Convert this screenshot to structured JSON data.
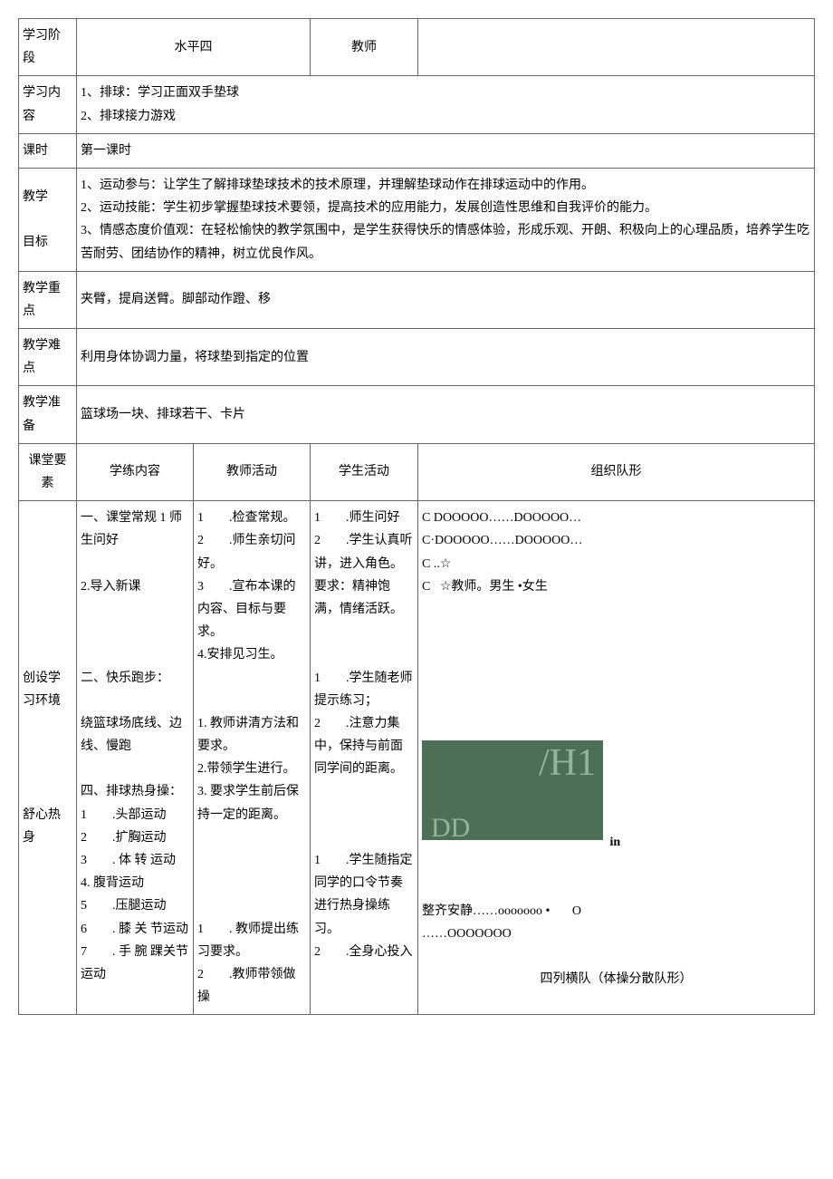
{
  "header": {
    "stage_label": "学习阶段",
    "stage_value": "水平四",
    "teacher_label": "教师",
    "teacher_value": ""
  },
  "content": {
    "label": "学习内容",
    "line1": "1、排球：学习正面双手垫球",
    "line2": "2、排球接力游戏"
  },
  "period": {
    "label": "课时",
    "value": "第一课时"
  },
  "objectives": {
    "label1": "教学",
    "label2": "目标",
    "line1": "1、运动参与：让学生了解排球垫球技术的技术原理，并理解垫球动作在排球运动中的作用。",
    "line2": "2、运动技能：学生初步掌握垫球技术要领，提高技术的应用能力，发展创造性思维和自我评价的能力。",
    "line3": "3、情感态度价值观：在轻松愉快的教学氛围中，是学生获得快乐的情感体验，形成乐观、开朗、积极向上的心理品质，培养学生吃苦耐劳、团结协作的精神，树立优良作风。"
  },
  "keypoint": {
    "label": "教学重点",
    "value": "夹臂，提肩送臂。脚部动作蹬、移"
  },
  "difficulty": {
    "label": "教学难点",
    "value": "利用身体协调力量，将球垫到指定的位置"
  },
  "prep": {
    "label": "教学准备",
    "value": "篮球场一块、排球若干、卡片"
  },
  "columns": {
    "c0": "课堂要素",
    "c1": "学练内容",
    "c2": "教师活动",
    "c3": "学生活动",
    "c4": "组织队形"
  },
  "row1": {
    "label_a": "创设学习环境",
    "label_b": "舒心热身",
    "content_a": "一、课堂常规 1 师生问好",
    "content_b": "2.导入新课",
    "content_c": "二、快乐跑步：",
    "content_d": "绕篮球场底线、边线、慢跑",
    "content_e": "四、排球热身操：",
    "content_f1": "1        .头部运动",
    "content_f2": "2        .扩胸运动",
    "content_f3": "3        . 体 转 运动",
    "content_f4": "4. 腹背运动",
    "content_f5": "5        .压腿运动",
    "content_f6": "6        . 膝 关 节运动",
    "content_f7": "7        . 手 腕 踝关节运动",
    "teacher_a1": "1        .检查常规。",
    "teacher_a2": "2        .师生亲切问好。",
    "teacher_a3": "3        .宣布本课的内容、目标与要求。",
    "teacher_a4": "4.安排见习生。",
    "teacher_b1": "1. 教师讲清方法和要求。",
    "teacher_b2": "2.带领学生进行。",
    "teacher_b3": "3. 要求学生前后保持一定的距离。",
    "teacher_c1": "1        . 教师提出练习要求。",
    "teacher_c2": "2        .教师带领做操",
    "student_a1": "1        .师生问好",
    "student_a2": "2        .学生认真听讲，进入角色。",
    "student_a3": "要求：精神饱满，情绪活跃。",
    "student_b1": "1        .学生随老师提示练习；",
    "student_b2": "2        .注意力集中，保持与前面同学间的距离。",
    "student_c1": "1        .学生随指定同学的口令节奏进行热身操练习。",
    "student_c2": "2        .全身心投入",
    "form_a1": "C DOOOOO……DOOOOO…",
    "form_a2": "C·DOOOOO……DOOOOO…",
    "form_a3": "C ..☆",
    "form_a4": "C   ☆教师。男生 •女生",
    "form_img_h": "/H1",
    "form_img_pp": "DD",
    "form_in": "in",
    "form_b1": "整齐安静……ooooooo •       O",
    "form_b2": "……OOOOOOO",
    "form_b3": "四列横队（体操分散队形）"
  }
}
